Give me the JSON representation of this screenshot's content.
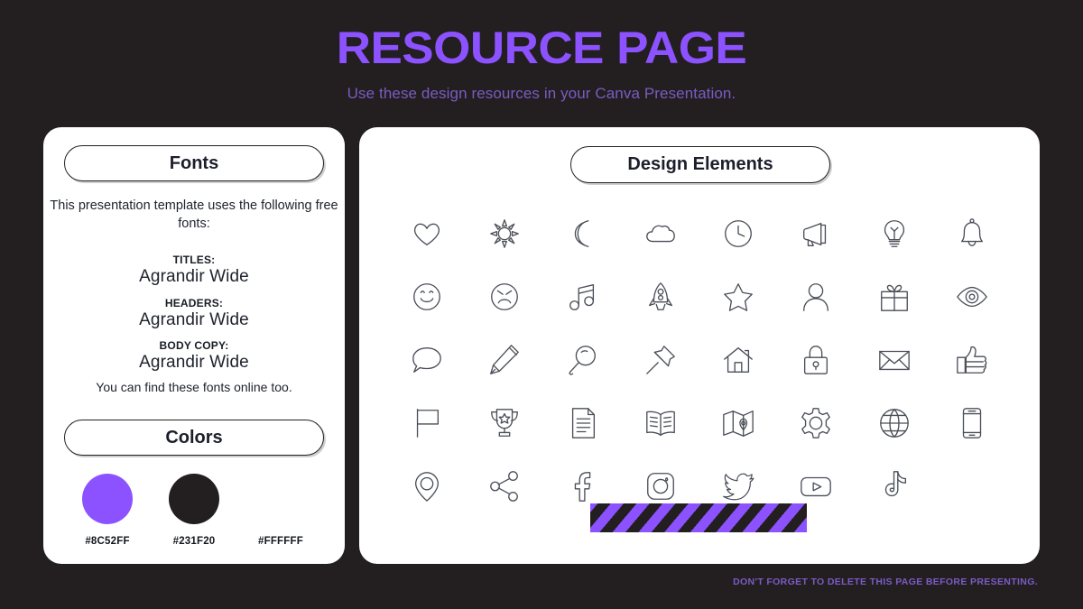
{
  "header": {
    "title": "RESOURCE PAGE",
    "subtitle": "Use these design resources in your Canva Presentation."
  },
  "fonts_panel": {
    "pill_label": "Fonts",
    "intro": "This presentation template uses the following free fonts:",
    "groups": [
      {
        "label": "TITLES:",
        "font": "Agrandir Wide"
      },
      {
        "label": "HEADERS:",
        "font": "Agrandir Wide"
      },
      {
        "label": "BODY COPY:",
        "font": "Agrandir Wide"
      }
    ],
    "outro": "You can find these fonts online too."
  },
  "colors_panel": {
    "pill_label": "Colors",
    "swatches": [
      {
        "hex": "#8C52FF",
        "value": "#8C52FF"
      },
      {
        "hex": "#231F20",
        "value": "#231F20"
      },
      {
        "hex": "#FFFFFF",
        "value": "#FFFFFF"
      }
    ]
  },
  "design_panel": {
    "pill_label": "Design Elements",
    "icons": [
      "heart-icon",
      "sun-icon",
      "moon-icon",
      "cloud-icon",
      "clock-icon",
      "megaphone-icon",
      "lightbulb-icon",
      "bell-icon",
      "smiley-face-icon",
      "sad-face-icon",
      "music-note-icon",
      "rocket-icon",
      "star-icon",
      "person-icon",
      "gift-icon",
      "eye-icon",
      "speech-bubble-icon",
      "pencil-icon",
      "magnifier-icon",
      "pushpin-icon",
      "house-icon",
      "lock-icon",
      "envelope-icon",
      "thumbs-up-icon",
      "flag-icon",
      "trophy-icon",
      "document-icon",
      "book-icon",
      "map-icon",
      "gear-icon",
      "globe-icon",
      "phone-icon",
      "location-pin-icon",
      "share-icon",
      "facebook-icon",
      "instagram-icon",
      "twitter-icon",
      "youtube-icon",
      "tiktok-icon"
    ],
    "stripe_bar": {
      "color_a": "#8C52FF",
      "color_b": "#231F20"
    }
  },
  "footer": {
    "note": "DON'T FORGET TO DELETE THIS PAGE BEFORE PRESENTING."
  },
  "theme": {
    "background": "#231F20",
    "accent": "#8C52FF",
    "card": "#FFFFFF"
  }
}
